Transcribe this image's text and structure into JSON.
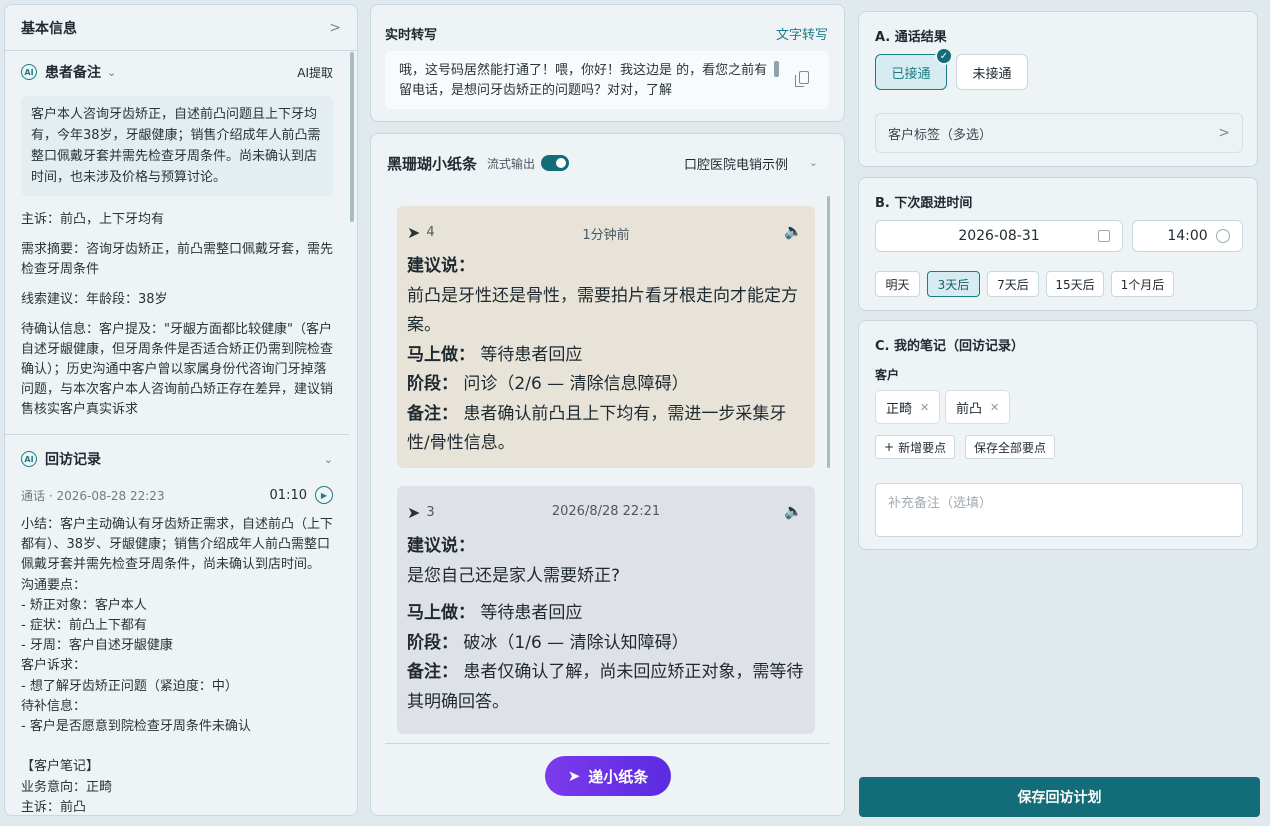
{
  "left": {
    "header": "基本信息",
    "patient_note": {
      "title": "患者备注",
      "icon_text": "AI",
      "ai_extract": "AI提取",
      "note": "客户本人咨询牙齿矫正，自述前凸问题且上下牙均有，今年38岁，牙龈健康；销售介绍成年人前凸需整口佩戴牙套并需先检查牙周条件。尚未确认到店时间，也未涉及价格与预算讨论。",
      "complaint": "主诉：前凸，上下牙均有",
      "demand": "需求摘要：咨询牙齿矫正，前凸需整口佩戴牙套，需先检查牙周条件",
      "lead": "线索建议：年龄段：38岁",
      "pending": "待确认信息：客户提及：\"牙龈方面都比较健康\"（客户自述牙龈健康，但牙周条件是否适合矫正仍需到院检查确认）；历史沟通中客户曾以家属身份代咨询门牙掉落问题，与本次客户本人咨询前凸矫正存在差异，建议销售核实客户真实诉求"
    },
    "followup": {
      "title": "回访记录",
      "meta": "通话 · 2026-08-28 22:23",
      "duration": "01:10",
      "summary": "小结：客户主动确认有牙齿矫正需求，自述前凸（上下都有）、38岁、牙龈健康；销售介绍成年人前凸需整口佩戴牙套并需先检查牙周条件，尚未确认到店时间。\n沟通要点：\n- 矫正对象：客户本人\n- 症状：前凸上下都有\n- 牙周：客户自述牙龈健康\n客户诉求：\n- 想了解牙齿矫正问题（紧迫度：中）\n待补信息：\n- 客户是否愿意到院检查牙周条件未确认\n\n【客户笔记】\n业务意向：正畸\n主诉：前凸"
    }
  },
  "transcript": {
    "title": "实时转写",
    "link": "文字转写",
    "text": "哦，这号码居然能打通了！喂，你好！我这边是 的，看您之前有留电话，是想问牙齿矫正的问题吗？对对，了解"
  },
  "notes": {
    "title": "黑珊瑚小纸条",
    "stream_label": "流式输出",
    "select_value": "口腔医院电销示例",
    "cards": [
      {
        "num": "4",
        "time": "1分钟前",
        "say_label": "建议说：",
        "say": "前凸是牙性还是骨性，需要拍片看牙根走向才能定方案。",
        "do_label": "马上做：",
        "do": "等待患者回应",
        "stage_label": "阶段：",
        "stage": "问诊（2/6 — 清除信息障碍）",
        "remark_label": "备注：",
        "remark": "患者确认前凸且上下均有，需进一步采集牙性/骨性信息。"
      },
      {
        "num": "3",
        "time": "2026/8/28 22:21",
        "say_label": "建议说：",
        "say": "是您自己还是家人需要矫正?",
        "do_label": "马上做：",
        "do": "等待患者回应",
        "stage_label": "阶段：",
        "stage": "破冰（1/6 — 清除认知障碍）",
        "remark_label": "备注：",
        "remark": "患者仅确认了解，尚未回应矫正对象，需等待其明确回答。"
      }
    ],
    "send_button": "递小纸条"
  },
  "secA": {
    "title": "A. 通话结果",
    "connected": "已接通",
    "not_connected": "未接通",
    "tags_label": "客户标签（多选）"
  },
  "secB": {
    "title": "B. 下次跟进时间",
    "date": "2026-08-31",
    "time": "14:00",
    "chips": [
      "明天",
      "3天后",
      "7天后",
      "15天后",
      "1个月后"
    ],
    "active_chip": "3天后"
  },
  "secC": {
    "title": "C. 我的笔记（回访记录）",
    "customer_label": "客户",
    "keywords": [
      "正畸",
      "前凸"
    ],
    "add_point": "新增要点",
    "save_points": "保存全部要点",
    "remark_placeholder": "补充备注（选填）"
  },
  "save_plan": "保存回访计划",
  "colors": {
    "accent": "#136d79",
    "card_recent": "#e8e3d8",
    "card_old": "#dfe1e8",
    "send_button": "#6d33eb"
  }
}
